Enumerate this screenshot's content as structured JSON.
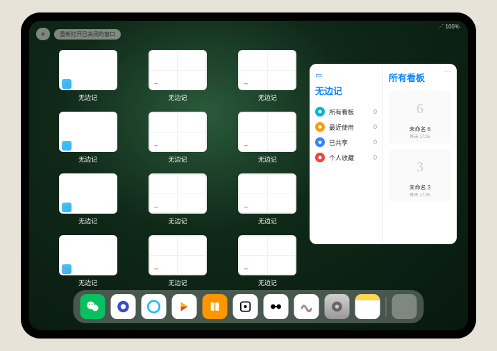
{
  "status": {
    "wifi": "⋰",
    "battery": "100%"
  },
  "topbar": {
    "plus": "+",
    "reopen": "重新打开已关闭的窗口"
  },
  "app_name": "无边记",
  "thumbnails": [
    {
      "style": "blank",
      "label": "无边记"
    },
    {
      "style": "grid",
      "label": "无边记"
    },
    {
      "style": "grid",
      "label": "无边记"
    },
    {
      "style": "blank",
      "label": "无边记"
    },
    {
      "style": "grid",
      "label": "无边记"
    },
    {
      "style": "grid",
      "label": "无边记"
    },
    {
      "style": "blank",
      "label": "无边记"
    },
    {
      "style": "grid",
      "label": "无边记"
    },
    {
      "style": "grid",
      "label": "无边记"
    },
    {
      "style": "blank",
      "label": "无边记"
    },
    {
      "style": "grid",
      "label": "无边记"
    },
    {
      "style": "grid",
      "label": "无边记"
    }
  ],
  "panel": {
    "left_title": "无边记",
    "right_title": "所有看板",
    "more": "···",
    "items": [
      {
        "icon": "cyan",
        "label": "所有看板",
        "count": "0"
      },
      {
        "icon": "orange",
        "label": "最近使用",
        "count": "0"
      },
      {
        "icon": "blue",
        "label": "已共享",
        "count": "0"
      },
      {
        "icon": "red",
        "label": "个人收藏",
        "count": "0"
      }
    ],
    "boards": [
      {
        "sketch": "6",
        "name": "未命名 6",
        "date": "昨天 17:25"
      },
      {
        "sketch": "3",
        "name": "未命名 3",
        "date": "昨天 17:25"
      }
    ]
  },
  "dock": [
    {
      "name": "wechat",
      "class": "i-wechat"
    },
    {
      "name": "quark",
      "class": "i-quark"
    },
    {
      "name": "qq-browser",
      "class": "i-qq"
    },
    {
      "name": "play",
      "class": "i-play"
    },
    {
      "name": "books",
      "class": "i-books"
    },
    {
      "name": "dice",
      "class": "i-dice"
    },
    {
      "name": "dumbbell",
      "class": "i-dumbbell"
    },
    {
      "name": "freeform",
      "class": "i-freeform"
    },
    {
      "name": "settings",
      "class": "i-settings"
    },
    {
      "name": "notes",
      "class": "i-notes"
    }
  ]
}
